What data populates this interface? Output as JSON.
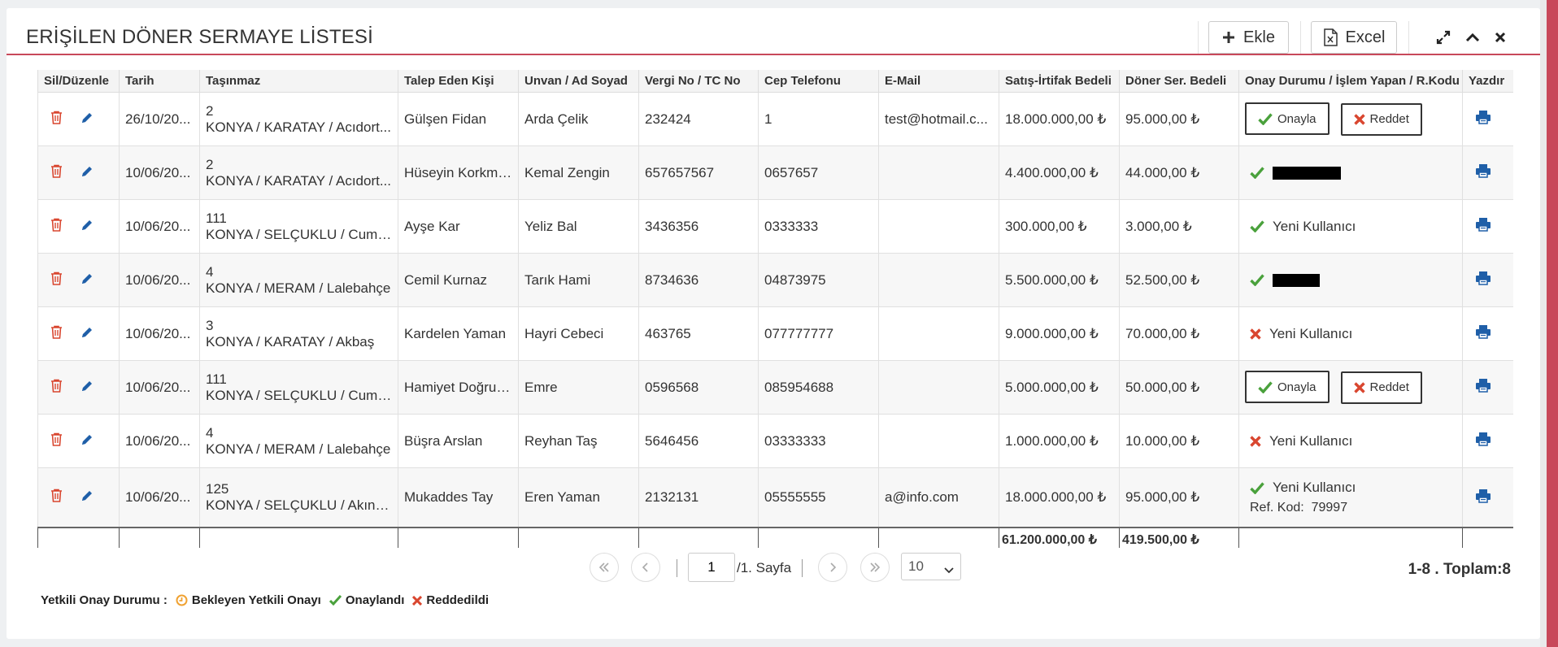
{
  "header": {
    "title": "ERİŞİLEN DÖNER SERMAYE LİSTESİ",
    "add_label": "Ekle",
    "excel_label": "Excel"
  },
  "columns": [
    "Sil/Düzenle",
    "Tarih",
    "Taşınmaz",
    "Talep Eden Kişi",
    "Unvan / Ad Soyad",
    "Vergi No / TC No",
    "Cep Telefonu",
    "E-Mail",
    "Satış-İrtifak Bedeli",
    "Döner Ser. Bedeli",
    "Onay Durumu / İşlem Yapan / R.Kodu",
    "Yazdır"
  ],
  "rows": [
    {
      "tarih": "26/10/20...",
      "no": "2",
      "adres": "KONYA / KARATAY / Acıdort...",
      "talep": "Gülşen Fidan",
      "unvan": "Arda Çelik",
      "vergi": "232424",
      "tel": "1",
      "email": "test@hotmail.c...",
      "satis": "18.000.000,00 ₺",
      "doner": "95.000,00 ₺",
      "status": {
        "type": "buttons",
        "onay": "Onayla",
        "reddet": "Reddet"
      }
    },
    {
      "tarih": "10/06/20...",
      "no": "2",
      "adres": "KONYA / KARATAY / Acıdort...",
      "talep": "Hüseyin Korkmaz",
      "unvan": "Kemal Zengin",
      "vergi": "657657567",
      "tel": "0657657",
      "email": "",
      "satis": "4.400.000,00 ₺",
      "doner": "44.000,00 ₺",
      "status": {
        "type": "approved",
        "text": "",
        "redacted": true
      }
    },
    {
      "tarih": "10/06/20...",
      "no": "111",
      "adres": "KONYA / SELÇUKLU / Cumh...",
      "talep": "Ayşe Kar",
      "unvan": "Yeliz Bal",
      "vergi": "3436356",
      "tel": "0333333",
      "email": "",
      "satis": "300.000,00 ₺",
      "doner": "3.000,00 ₺",
      "status": {
        "type": "approved",
        "text": "Yeni Kullanıcı"
      }
    },
    {
      "tarih": "10/06/20...",
      "no": "4",
      "adres": "KONYA / MERAM / Lalebahçe",
      "talep": "Cemil Kurnaz",
      "unvan": "Tarık Hami",
      "vergi": "8734636",
      "tel": "04873975",
      "email": "",
      "satis": "5.500.000,00 ₺",
      "doner": "52.500,00 ₺",
      "status": {
        "type": "approved",
        "text": "",
        "redacted": true
      }
    },
    {
      "tarih": "10/06/20...",
      "no": "3",
      "adres": "KONYA / KARATAY / Akbaş",
      "talep": "Kardelen Yaman",
      "unvan": "Hayri Cebeci",
      "vergi": "463765",
      "tel": "077777777",
      "email": "",
      "satis": "9.000.000,00 ₺",
      "doner": "70.000,00 ₺",
      "status": {
        "type": "rejected",
        "text": "Yeni Kullanıcı"
      }
    },
    {
      "tarih": "10/06/20...",
      "no": "111",
      "adres": "KONYA / SELÇUKLU / Cumh...",
      "talep": "Hamiyet Doğrusöz",
      "unvan": "Emre",
      "vergi": "0596568",
      "tel": "085954688",
      "email": "",
      "satis": "5.000.000,00 ₺",
      "doner": "50.000,00 ₺",
      "status": {
        "type": "buttons",
        "onay": "Onayla",
        "reddet": "Reddet"
      }
    },
    {
      "tarih": "10/06/20...",
      "no": "4",
      "adres": "KONYA / MERAM / Lalebahçe",
      "talep": "Büşra Arslan",
      "unvan": "Reyhan Taş",
      "vergi": "5646456",
      "tel": "03333333",
      "email": "",
      "satis": "1.000.000,00 ₺",
      "doner": "10.000,00 ₺",
      "status": {
        "type": "rejected",
        "text": "Yeni Kullanıcı"
      }
    },
    {
      "tarih": "10/06/20...",
      "no": "125",
      "adres": "KONYA / SELÇUKLU / Akıncıl...",
      "talep": "Mukaddes Tay",
      "unvan": "Eren Yaman",
      "vergi": "2132131",
      "tel": "05555555",
      "email": "a@info.com",
      "satis": "18.000.000,00 ₺",
      "doner": "95.000,00 ₺",
      "status": {
        "type": "approved",
        "text": "Yeni Kullanıcı",
        "ref_label": "Ref. Kod:",
        "ref_code": "79997"
      }
    }
  ],
  "totals": {
    "satis": "61.200.000,00 ₺",
    "doner": "419.500,00 ₺"
  },
  "pager": {
    "page": "1",
    "page_text": "/1. Sayfa",
    "page_size": "10",
    "summary": "1-8 . Toplam:8"
  },
  "legend": {
    "title": "Yetkili Onay Durumu :",
    "pending": "Bekleyen Yetkili Onayı",
    "approved": "Onaylandı",
    "rejected": "Reddedildi"
  },
  "colors": {
    "accent": "#c8485a",
    "approve": "#4aa13c",
    "reject": "#d9462f",
    "edit": "#1f5fa8",
    "delete": "#d9462f",
    "pending": "#f0a232"
  }
}
